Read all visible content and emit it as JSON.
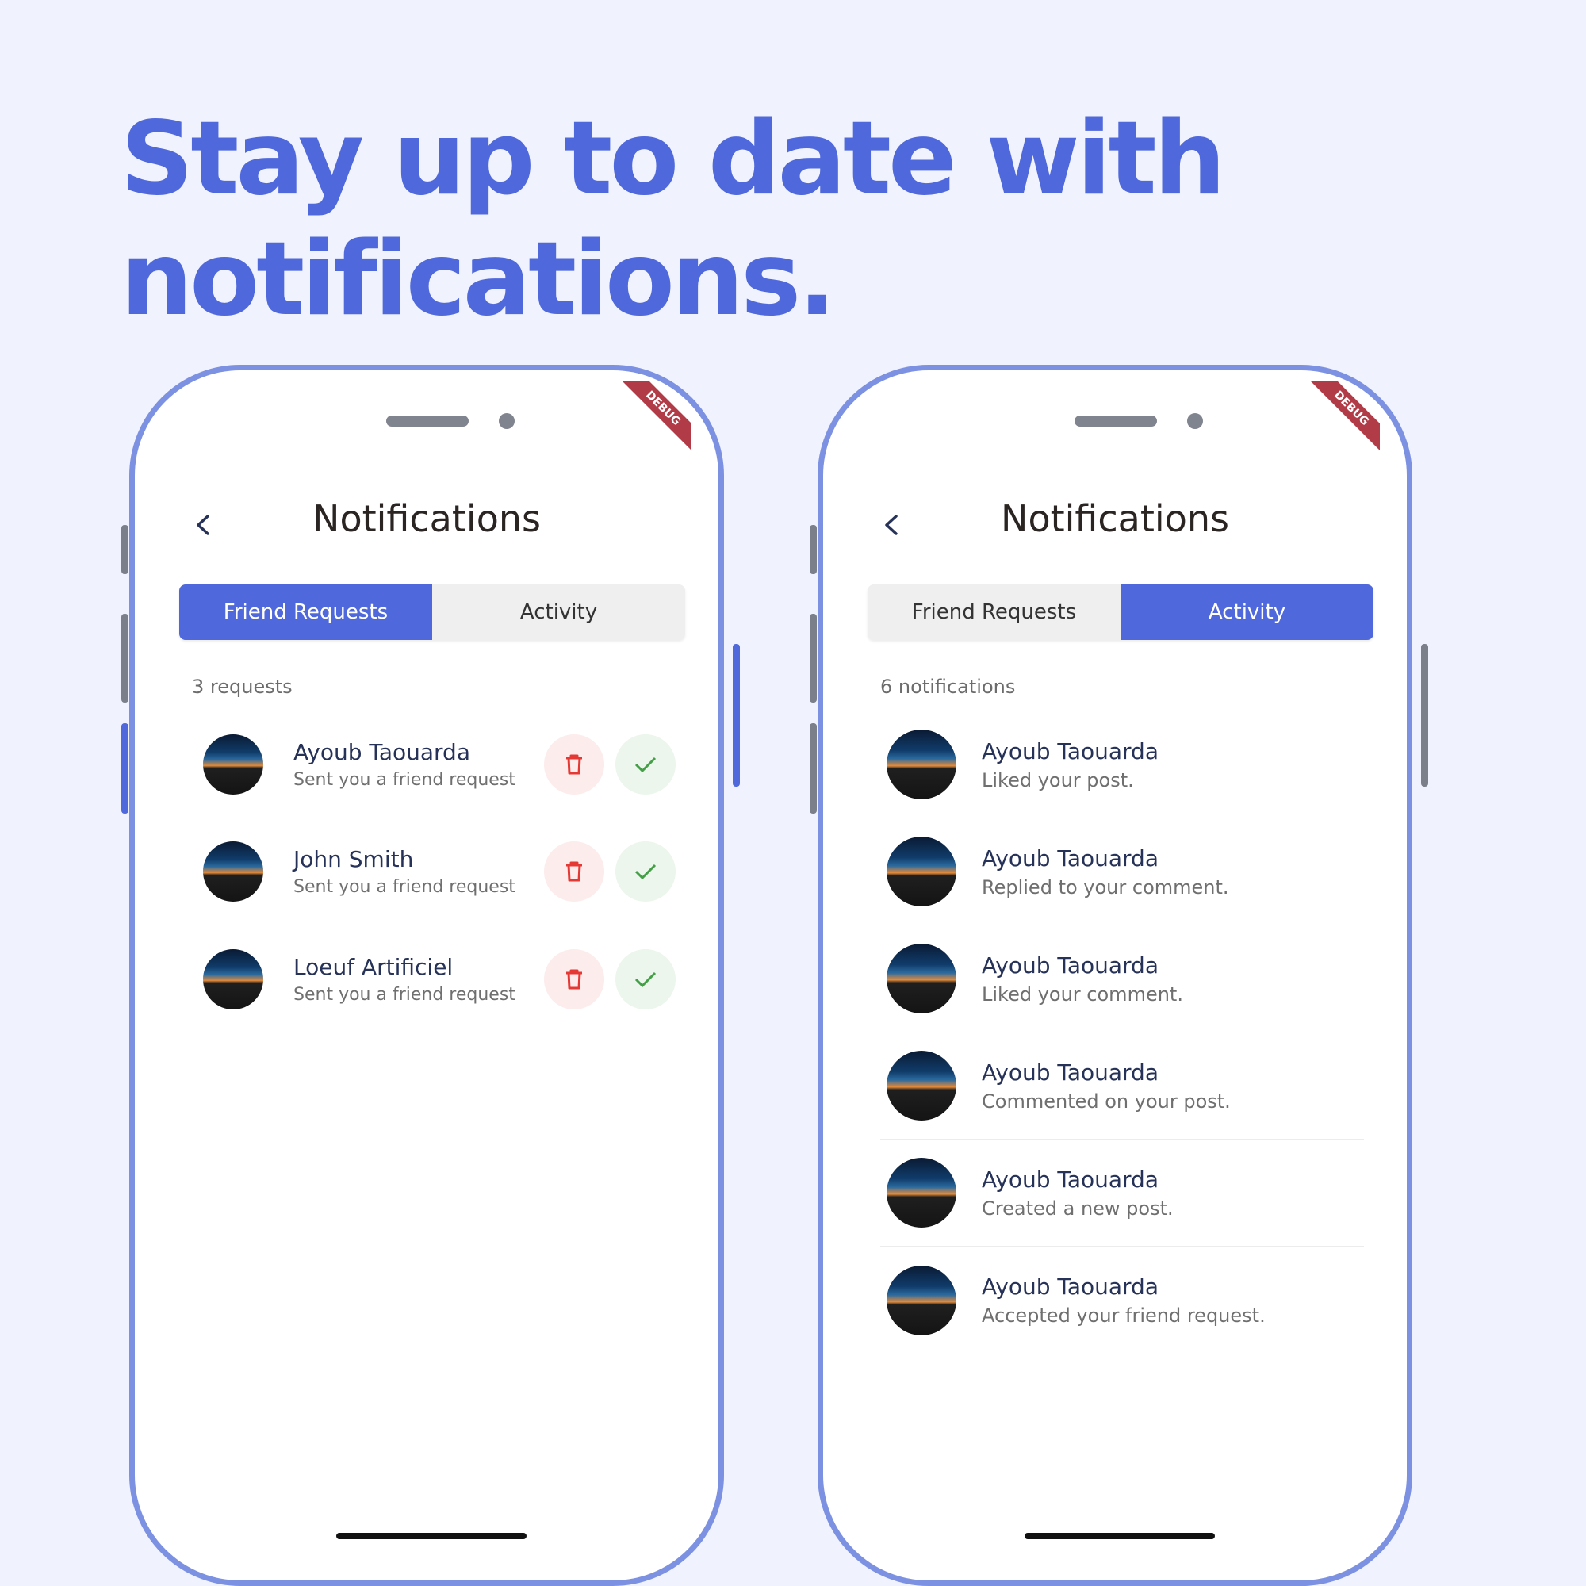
{
  "headline": {
    "line1": "Stay up to date with",
    "line2": "notifications."
  },
  "badge": "DEBUG",
  "left_screen": {
    "title": "Notifications",
    "tabs": [
      {
        "label": "Friend Requests",
        "active": true
      },
      {
        "label": "Activity",
        "active": false
      }
    ],
    "count_label": "3 requests",
    "requests": [
      {
        "name": "Ayoub Taouarda",
        "text": "Sent you a friend request"
      },
      {
        "name": "John Smith",
        "text": "Sent you a friend request"
      },
      {
        "name": "Loeuf Artificiel",
        "text": "Sent you a friend request"
      }
    ]
  },
  "right_screen": {
    "title": "Notifications",
    "tabs": [
      {
        "label": "Friend Requests",
        "active": false
      },
      {
        "label": "Activity",
        "active": true
      }
    ],
    "count_label": "6 notifications",
    "notifications": [
      {
        "name": "Ayoub Taouarda",
        "text": "Liked your post."
      },
      {
        "name": "Ayoub Taouarda",
        "text": "Replied to your comment."
      },
      {
        "name": "Ayoub Taouarda",
        "text": "Liked your comment."
      },
      {
        "name": "Ayoub Taouarda",
        "text": "Commented on your post."
      },
      {
        "name": "Ayoub Taouarda",
        "text": "Created a new post."
      },
      {
        "name": "Ayoub Taouarda",
        "text": "Accepted your friend request."
      }
    ]
  },
  "colors": {
    "accent": "#4f68db",
    "phone_frame": "#7c91e2",
    "delete": "#e53935",
    "accept": "#43a047"
  },
  "icons": {
    "back": "chevron-left-icon",
    "delete": "trash-icon",
    "accept": "check-icon"
  }
}
